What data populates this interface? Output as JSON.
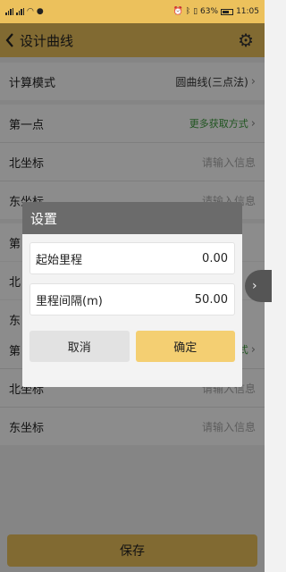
{
  "status_bar": {
    "battery": "63%",
    "time": "11:05"
  },
  "header": {
    "title": "设计曲线"
  },
  "form": {
    "calc_mode_label": "计算模式",
    "calc_mode_value": "圆曲线(三点法)",
    "point1_label": "第一点",
    "more_methods": "更多获取方式",
    "north_label": "北坐标",
    "east_label": "东坐标",
    "placeholder": "请输入信息"
  },
  "dialog": {
    "title": "设置",
    "start_label": "起始里程",
    "start_value": "0.00",
    "interval_label": "里程间隔(m)",
    "interval_value": "50.00",
    "cancel": "取消",
    "confirm": "确定"
  },
  "save": "保存"
}
